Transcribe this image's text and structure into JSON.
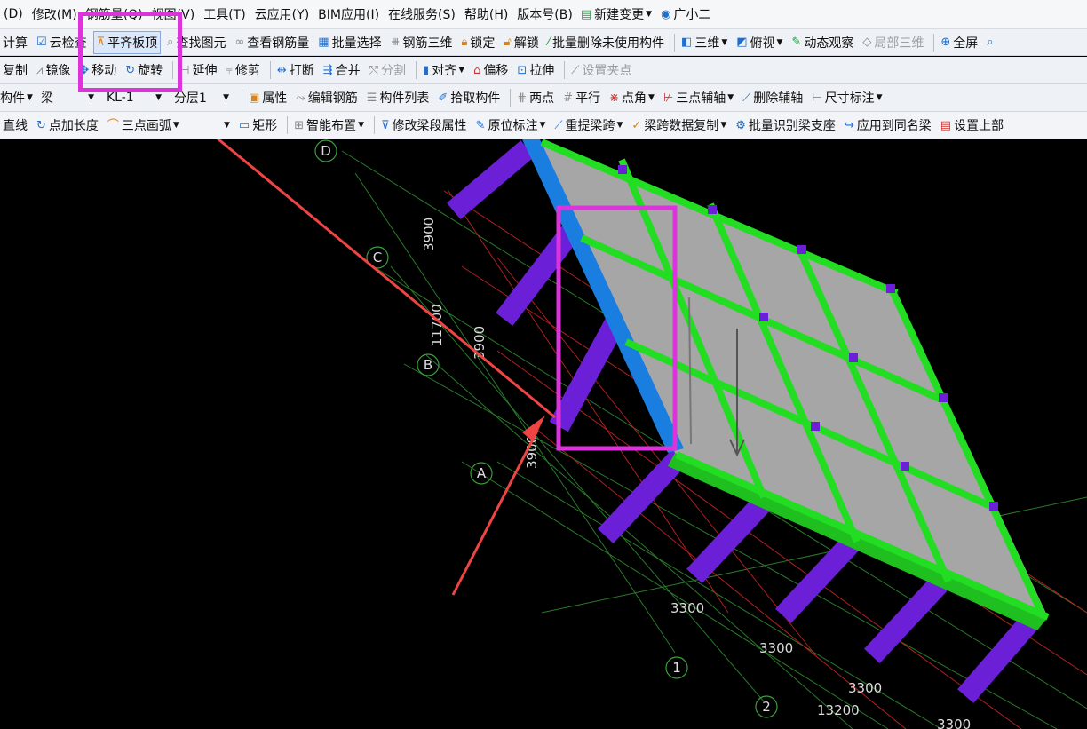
{
  "menubar": {
    "items": [
      "(D)",
      "修改(M)",
      "钢筋量(Q)",
      "视图(V)",
      "工具(T)",
      "云应用(Y)",
      "BIM应用(I)",
      "在线服务(S)",
      "帮助(H)",
      "版本号(B)",
      "新建变更",
      "广小二"
    ]
  },
  "toolbar1": {
    "items": [
      "计算",
      "云检查",
      "平齐板顶",
      "查找图元",
      "查看钢筋量",
      "批量选择",
      "钢筋三维",
      "锁定",
      "解锁",
      "批量删除未使用构件",
      "三维",
      "俯视",
      "动态观察",
      "局部三维",
      "全屏"
    ]
  },
  "toolbar2": {
    "items": [
      "复制",
      "镜像",
      "移动",
      "旋转",
      "延伸",
      "修剪",
      "打断",
      "合并",
      "分割",
      "对齐",
      "偏移",
      "拉伸",
      "设置夹点"
    ]
  },
  "toolbar3": {
    "component_label": "构件",
    "type_value": "梁",
    "name_value": "KL-1",
    "layer_value": "分层1",
    "items": [
      "属性",
      "编辑钢筋",
      "构件列表",
      "拾取构件",
      "两点",
      "平行",
      "点角",
      "三点辅轴",
      "删除辅轴",
      "尺寸标注"
    ]
  },
  "toolbar4": {
    "items": [
      "直线",
      "点加长度",
      "三点画弧",
      "矩形",
      "智能布置",
      "修改梁段属性",
      "原位标注",
      "重提梁跨",
      "梁跨数据复制",
      "批量识别梁支座",
      "应用到同名梁",
      "设置上部"
    ]
  },
  "viewport": {
    "axis_labels": [
      "D",
      "C",
      "B",
      "A",
      "1",
      "2"
    ],
    "dimensions": [
      "3900",
      "3900",
      "3900",
      "11700",
      "3300",
      "3300",
      "3300",
      "3300",
      "13200"
    ]
  },
  "colors": {
    "slab": "#a6a6a6",
    "beam_green": "#22dd22",
    "beam_blue": "#1a7de0",
    "column": "#6b1fd6",
    "highlight": "#dd33dd",
    "arrow": "#ee4444"
  }
}
